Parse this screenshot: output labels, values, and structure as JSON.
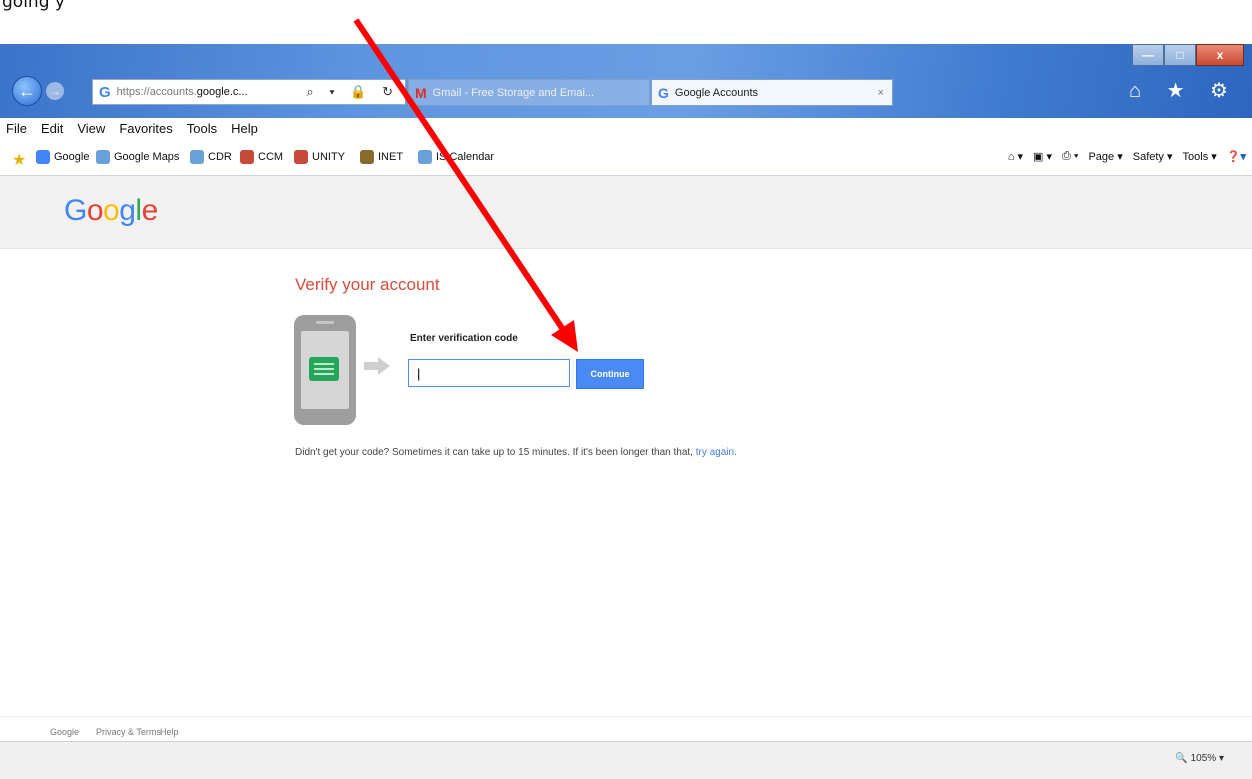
{
  "caption_text": "going y",
  "browser": {
    "address": {
      "url_prefix": "https://accounts.",
      "url_domain": "google.c...",
      "tools_glyphs": "⌕ ▾ 🔒 ↻"
    },
    "tabs": [
      {
        "icon": "M",
        "label": "Gmail - Free Storage and Emai...",
        "active": false
      },
      {
        "icon": "G",
        "label": "Google Accounts",
        "active": true,
        "close": "×"
      }
    ],
    "window_controls": {
      "minimize": "—",
      "maximize": "□",
      "close": "x"
    },
    "right_icons": "⌂ ★ ⚙",
    "menu": [
      "File",
      "Edit",
      "View",
      "Favorites",
      "Tools",
      "Help"
    ],
    "favorites": [
      {
        "label": "Google",
        "color": "#4285f4"
      },
      {
        "label": "Google Maps",
        "color": "#6aa0d8"
      },
      {
        "label": "CDR",
        "color": "#6aa0d8"
      },
      {
        "label": "CCM",
        "color": "#c54a3a"
      },
      {
        "label": "UNITY",
        "color": "#c54a3a"
      },
      {
        "label": "INET",
        "color": "#8a6a2a"
      },
      {
        "label": "IS Calendar",
        "color": "#6aa0d8"
      }
    ],
    "command_bar": [
      "Page ▾",
      "Safety ▾",
      "Tools ▾"
    ],
    "zoom": "105%"
  },
  "page": {
    "logo": "Google",
    "title": "Verify your account",
    "code_label": "Enter verification code",
    "code_value": "|",
    "continue_label": "Continue",
    "help_text": "Didn't get your code? Sometimes it can take up to 15 minutes. If it's been longer than that,",
    "try_again": "try again."
  },
  "footer": {
    "brand": "Google",
    "privacy": "Privacy & Terms",
    "help": "Help"
  },
  "colors": {
    "accent": "#4a8af4",
    "title": "#dd4b39",
    "annotation_arrow": "#ff0000"
  }
}
